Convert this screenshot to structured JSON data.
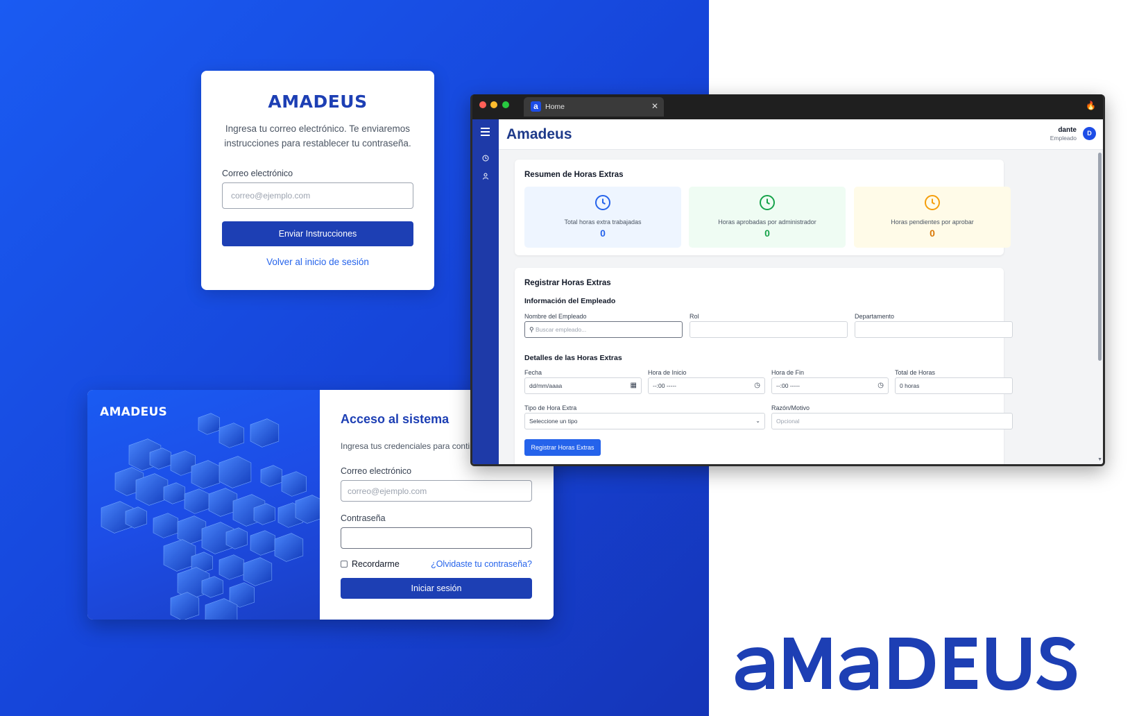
{
  "colors": {
    "brand_blue": "#1d3fb4",
    "link_blue": "#2563eb",
    "sidebar": "#1e3aa8"
  },
  "forgot": {
    "logo": "AMADEUS",
    "description": "Ingresa tu correo electrónico. Te enviaremos instrucciones para restablecer tu contraseña.",
    "email_label": "Correo electrónico",
    "email_placeholder": "correo@ejemplo.com",
    "submit": "Enviar Instrucciones",
    "back_link": "Volver al inicio de sesión"
  },
  "login": {
    "logo": "AMADEUS",
    "title": "Acceso al sistema",
    "subtitle": "Ingresa tus credenciales para contin",
    "email_label": "Correo electrónico",
    "email_placeholder": "correo@ejemplo.com",
    "password_label": "Contraseña",
    "remember": "Recordarme",
    "forgot": "¿Olvidaste tu contraseña?",
    "submit": "Iniciar sesión"
  },
  "browser": {
    "tab_title": "Home",
    "tab_icon": "amadeus-a-icon",
    "app": {
      "brand": "Amadeus",
      "user_name": "dante",
      "user_role": "Empleado",
      "avatar": "D",
      "sidebar_icons": [
        "menu-icon",
        "clock-icon",
        "user-icon"
      ],
      "summary": {
        "title": "Resumen de Horas Extras",
        "stats": [
          {
            "label": "Total horas extra trabajadas",
            "value": "0",
            "color": "#2563eb",
            "bg": "#eef5ff"
          },
          {
            "label": "Horas aprobadas por administrador",
            "value": "0",
            "color": "#16a34a",
            "bg": "#effcf3"
          },
          {
            "label": "Horas pendientes por aprobar",
            "value": "0",
            "color": "#d97706",
            "bg": "#fffbe8"
          }
        ]
      },
      "register": {
        "title": "Registrar Horas Extras",
        "employee_section": "Información del Empleado",
        "name_label": "Nombre del Empleado",
        "name_placeholder": "Buscar empleado...",
        "role_label": "Rol",
        "dept_label": "Departamento",
        "details_section": "Detalles de las Horas Extras",
        "date_label": "Fecha",
        "date_value": "dd/mm/aaaa",
        "start_label": "Hora de Inicio",
        "start_value": "--:00 -----",
        "end_label": "Hora de Fin",
        "end_value": "--:00 -----",
        "total_label": "Total de Horas",
        "total_value": "0 horas",
        "type_label": "Tipo de Hora Extra",
        "type_value": "Seleccione un tipo",
        "reason_label": "Razón/Motivo",
        "reason_placeholder": "Opcional",
        "submit": "Registrar Horas Extras"
      }
    }
  },
  "big_logo": "amadeus"
}
